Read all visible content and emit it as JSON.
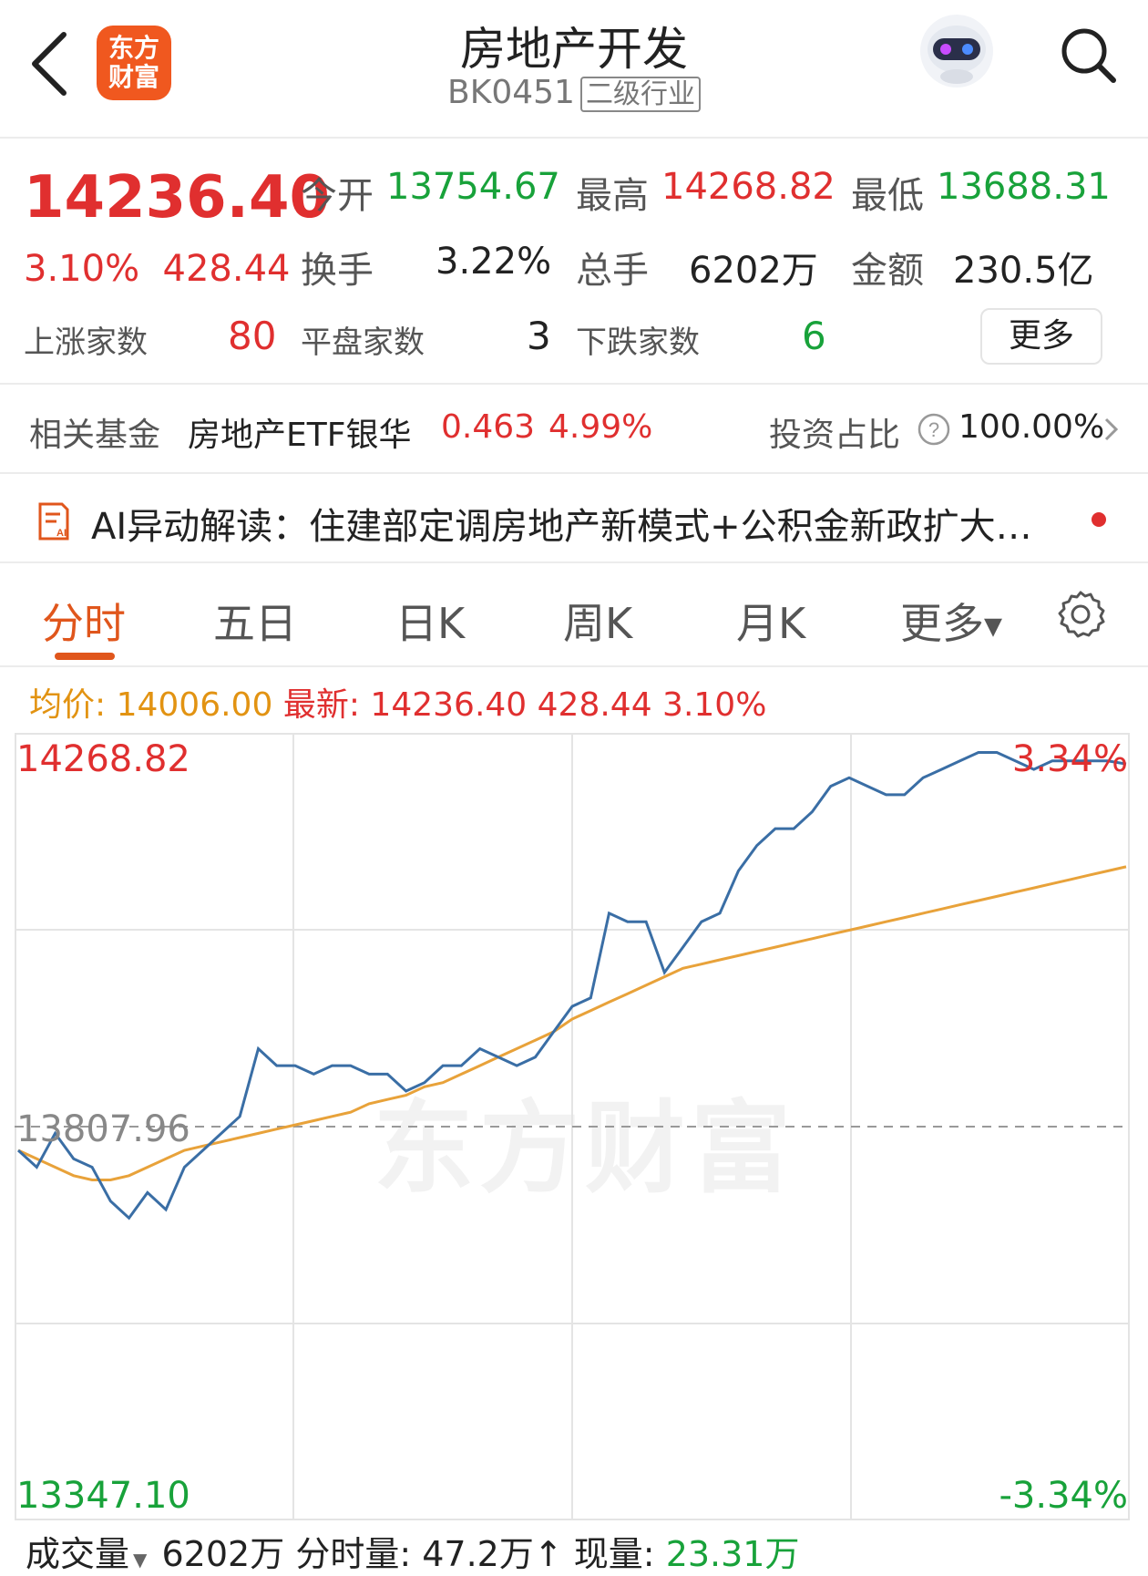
{
  "header": {
    "title": "房地产开发",
    "code": "BK0451",
    "badge": "二级行业",
    "logo_line1": "东方",
    "logo_line2": "财富"
  },
  "quote": {
    "price": "14236.40",
    "change_pct": "3.10%",
    "change_abs": "428.44",
    "open_label": "今开",
    "open": "13754.67",
    "high_label": "最高",
    "high": "14268.82",
    "low_label": "最低",
    "low": "13688.31",
    "turnover_label": "换手",
    "turnover": "3.22%",
    "volume_label": "总手",
    "volume": "6202万",
    "amount_label": "金额",
    "amount": "230.5亿",
    "up_label": "上涨家数",
    "up": "80",
    "flat_label": "平盘家数",
    "flat": "3",
    "down_label": "下跌家数",
    "down": "6",
    "more": "更多"
  },
  "fund": {
    "label": "相关基金",
    "name": "房地产ETF银华",
    "price": "0.463",
    "pct": "4.99%",
    "ratio_label": "投资占比",
    "ratio": "100.00%"
  },
  "ai": {
    "text": "AI异动解读：住建部定调房地产新模式+公积金新政扩大…"
  },
  "tabs": [
    "分时",
    "五日",
    "日K",
    "周K",
    "月K",
    "更多"
  ],
  "info": {
    "avg_label": "均价:",
    "avg": "14006.00",
    "latest_label": "最新:",
    "latest": "14236.40 428.44 3.10%"
  },
  "chart_data": {
    "type": "line",
    "y_top_label": "14268.82",
    "y_mid_label": "13807.96",
    "y_bottom_label": "13347.10",
    "pct_top_label": "3.34%",
    "pct_bottom_label": "-3.34%",
    "ylim": [
      13347.1,
      14268.82
    ],
    "prev_close": 13807.96,
    "x": [
      0,
      1,
      2,
      3,
      4,
      5,
      6,
      7,
      8,
      9,
      10,
      11,
      12,
      13,
      14,
      15,
      16,
      17,
      18,
      19,
      20,
      21,
      22,
      23,
      24,
      25,
      26,
      27,
      28,
      29,
      30,
      31,
      32,
      33,
      34,
      35,
      36,
      37,
      38,
      39,
      40,
      41,
      42,
      43,
      44,
      45,
      46,
      47,
      48,
      49,
      50,
      51,
      52,
      53,
      54,
      55,
      56,
      57,
      58,
      59,
      60
    ],
    "series": [
      {
        "values": [
          13780,
          13760,
          13800,
          13770,
          13760,
          13720,
          13700,
          13730,
          13710,
          13760,
          13780,
          13800,
          13820,
          13900,
          13880,
          13880,
          13870,
          13880,
          13880,
          13870,
          13870,
          13850,
          13860,
          13880,
          13880,
          13900,
          13890,
          13880,
          13890,
          13920,
          13950,
          13960,
          14060,
          14050,
          14050,
          13990,
          14020,
          14050,
          14060,
          14110,
          14140,
          14160,
          14160,
          14180,
          14210,
          14220,
          14210,
          14200,
          14200,
          14220,
          14230,
          14240,
          14250,
          14250,
          14240,
          14230,
          14240,
          14240,
          14240,
          14240,
          14236.4
        ]
      },
      {
        "values": [
          13780,
          13770,
          13760,
          13750,
          13745,
          13745,
          13750,
          13760,
          13770,
          13780,
          13785,
          13790,
          13795,
          13800,
          13805,
          13810,
          13815,
          13820,
          13825,
          13835,
          13840,
          13845,
          13855,
          13860,
          13870,
          13880,
          13890,
          13900,
          13910,
          13920,
          13935,
          13945,
          13955,
          13965,
          13975,
          13985,
          13995,
          14000,
          14005,
          14010,
          14015,
          14020,
          14025,
          14030,
          14035,
          14040,
          14045,
          14050,
          14055,
          14060,
          14065,
          14070,
          14075,
          14080,
          14085,
          14090,
          14095,
          14100,
          14105,
          14110,
          14115
        ]
      }
    ],
    "colors": {
      "price": "#3a6ea5",
      "avg": "#e8a23a",
      "grid": "#e4e4e4",
      "prev_close": "#999999"
    }
  },
  "volume": {
    "label": "成交量",
    "total": "6202万",
    "tick_label": "分时量:",
    "tick": "47.2万",
    "current_label": "现量:",
    "current": "23.31万"
  },
  "watermark": "东方财富"
}
